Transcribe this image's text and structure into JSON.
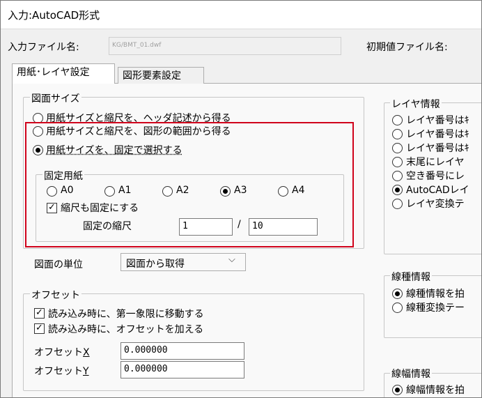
{
  "window": {
    "title": "入力:AutoCAD形式"
  },
  "input_file": {
    "label": "入力ファイル名:",
    "value": "KG/BMT_01.dwf",
    "initial_label": "初期値ファイル名:"
  },
  "tabs": [
    {
      "label": "用紙･レイヤ設定"
    },
    {
      "label": "図形要素設定"
    }
  ],
  "drawing_size": {
    "title": "図面サイズ",
    "options": [
      "用紙サイズと縮尺を、ヘッダ記述から得る",
      "用紙サイズと縮尺を、図形の範囲から得る",
      "用紙サイズを、固定で選択する"
    ],
    "selected_index": 2,
    "fixed_paper": {
      "title": "固定用紙",
      "sizes": [
        "A0",
        "A1",
        "A2",
        "A3",
        "A4"
      ],
      "selected": "A3",
      "fix_scale_label": "縮尺も固定にする",
      "fix_scale_checked": true,
      "scale_label": "固定の縮尺",
      "scale_num": "1",
      "scale_sep": "/",
      "scale_den": "10"
    }
  },
  "units": {
    "label": "図面の単位",
    "value": "図面から取得"
  },
  "offset": {
    "title": "オフセット",
    "checks": [
      {
        "label": "読み込み時に、第一象限に移動する",
        "checked": true
      },
      {
        "label": "読み込み時に、オフセットを加える",
        "checked": true
      }
    ],
    "x_label": "オフセット",
    "x_key": "X",
    "x_value": "0.000000",
    "y_label": "オフセット",
    "y_key": "Y",
    "y_value": "0.000000"
  },
  "layer_info": {
    "title": "レイヤ情報",
    "options": [
      "レイヤ番号はｷ",
      "レイヤ番号はｷ",
      "レイヤ番号はｷ",
      "末尾にレイヤ",
      "空き番号にレ",
      "AutoCADレイ",
      "レイヤ変換テ"
    ],
    "selected_index": 5
  },
  "linetype_info": {
    "title": "線種情報",
    "options": [
      "線種情報を拍",
      "線種変換テー"
    ],
    "selected_index": 0
  },
  "linewidth_info": {
    "title": "線幅情報",
    "options": [
      "線幅情報を拍"
    ],
    "selected_index": 0
  }
}
